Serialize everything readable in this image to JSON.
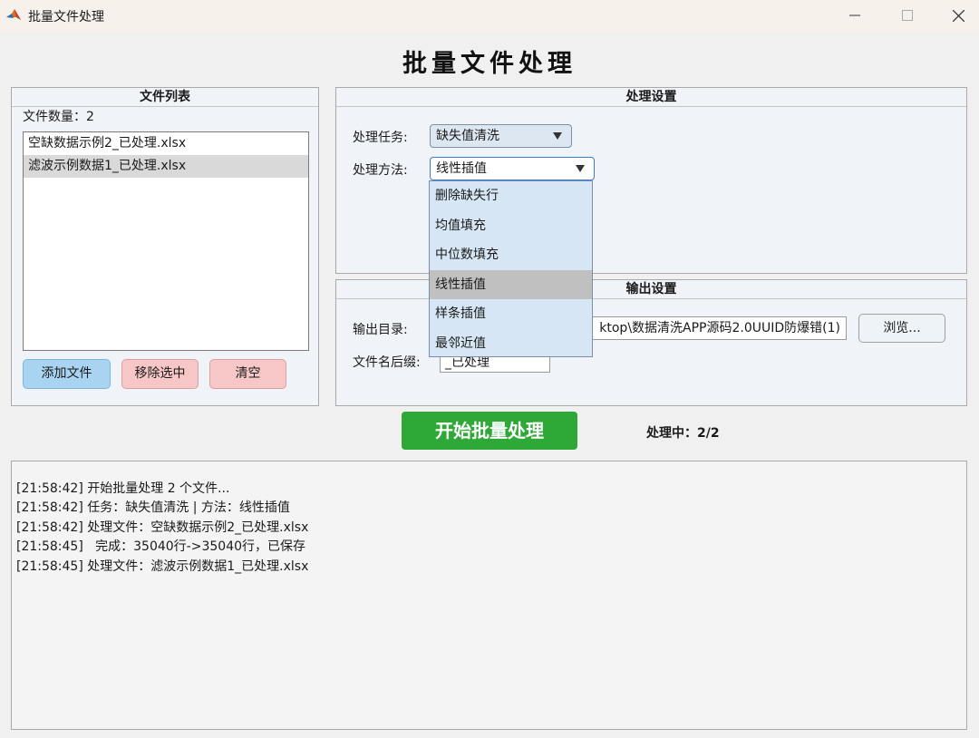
{
  "window": {
    "title": "批量文件处理"
  },
  "app": {
    "heading": "批量文件处理"
  },
  "file_panel": {
    "title": "文件列表",
    "count_label": "文件数量：2",
    "files": [
      "空缺数据示例2_已处理.xlsx",
      "滤波示例数据1_已处理.xlsx"
    ],
    "buttons": {
      "add": "添加文件",
      "remove": "移除选中",
      "clear": "清空"
    }
  },
  "processing": {
    "title": "处理设置",
    "task_label": "处理任务:",
    "task_value": "缺失值清洗",
    "method_label": "处理方法:",
    "method_value": "线性插值",
    "method_options": [
      "删除缺失行",
      "均值填充",
      "中位数填充",
      "线性插值",
      "样条插值",
      "最邻近值"
    ]
  },
  "output": {
    "title": "输出设置",
    "dir_label": "输出目录:",
    "dir_value": "ktop\\数据清洗APP源码2.0UUID防爆错(1)",
    "browse_label": "浏览...",
    "suffix_label": "文件名后缀:",
    "suffix_value": "_已处理"
  },
  "start_button": "开始批量处理",
  "status": "处理中：2/2",
  "log": [
    "[21:58:42] 开始批量处理 2 个文件...",
    "[21:58:42] 任务：缺失值清洗 | 方法：线性插值",
    "[21:58:42] 处理文件：空缺数据示例2_已处理.xlsx",
    "[21:58:45]   完成：35040行->35040行，已保存",
    "[21:58:45] 处理文件：滤波示例数据1_已处理.xlsx"
  ]
}
